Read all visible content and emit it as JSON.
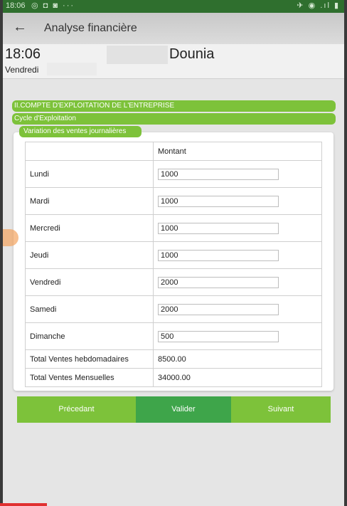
{
  "status_bar": {
    "time": "18:06",
    "left_icons": "◎ ◘ ◙ ···",
    "right_icons": "✈ ◉ .ıl ▮"
  },
  "app_bar": {
    "title": "Analyse financière",
    "back_icon": "←"
  },
  "header": {
    "time": "18:06",
    "name": "Dounia",
    "day": "Vendredi"
  },
  "sections": {
    "section_title": "II.COMPTE D'EXPLOITATION DE L'ENTREPRISE",
    "subsection_title": "Cycle d'Exploitation",
    "group_title": "Variation des ventes journalières"
  },
  "table": {
    "column_header": "Montant",
    "rows": [
      {
        "day": "Lundi",
        "value": "1000"
      },
      {
        "day": "Mardi",
        "value": "1000"
      },
      {
        "day": "Mercredi",
        "value": "1000"
      },
      {
        "day": "Jeudi",
        "value": "1000"
      },
      {
        "day": "Vendredi",
        "value": "2000"
      },
      {
        "day": "Samedi",
        "value": "2000"
      },
      {
        "day": "Dimanche",
        "value": "500"
      }
    ],
    "totals": [
      {
        "label": "Total Ventes hebdomadaires",
        "value": "8500.00"
      },
      {
        "label": "Total Ventes Mensuelles",
        "value": "34000.00"
      }
    ]
  },
  "buttons": {
    "previous": "Précedant",
    "validate": "Valider",
    "next": "Suivant"
  },
  "colors": {
    "accent_green": "#7dc23a",
    "validate_green": "#3ea54a",
    "status_bar": "#2f6f2e"
  }
}
